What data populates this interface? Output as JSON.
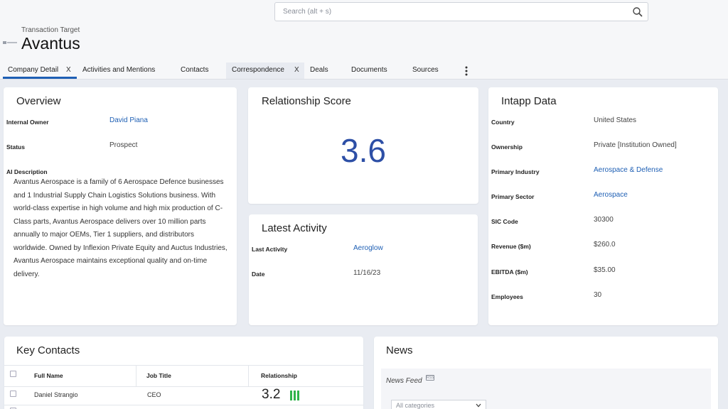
{
  "search": {
    "placeholder": "Search (alt + s)",
    "icon": "search-icon"
  },
  "header": {
    "subtitle": "Transaction Target",
    "title": "Avantus"
  },
  "tabs": [
    {
      "label": "Company Detail",
      "closable": true,
      "active": true
    },
    {
      "label": "Activities and Mentions"
    },
    {
      "label": "Contacts"
    },
    {
      "label": "Correspondence",
      "closable": true
    },
    {
      "label": "Deals"
    },
    {
      "label": "Documents"
    },
    {
      "label": "Sources"
    }
  ],
  "tab_close_label": "X",
  "overview": {
    "title": "Overview",
    "internal_owner_label": "Internal Owner",
    "internal_owner": "David Piana",
    "status_label": "Status",
    "status": "Prospect",
    "ai_description_label": "AI Description",
    "ai_description": "Avantus Aerospace is a family of 6 Aerospace Defence businesses and 1 Industrial Supply Chain Logistics Solutions business. With world-class expertise in high volume and high mix production of C-Class parts, Avantus Aerospace delivers over 10 million parts annually to major OEMs, Tier 1 suppliers, and distributors worldwide. Owned by Inflexion Private Equity and Auctus Industries, Avantus Aerospace maintains exceptional quality and on-time delivery."
  },
  "relationship_score": {
    "title": "Relationship Score",
    "value": "3.6",
    "color": "#2d4fa6"
  },
  "latest_activity": {
    "title": "Latest Activity",
    "last_activity_label": "Last Activity",
    "last_activity": "Aeroglow",
    "date_label": "Date",
    "date": "11/16/23"
  },
  "intapp_data": {
    "title": "Intapp Data",
    "fields": [
      {
        "label": "Country",
        "value": "United States",
        "link": false
      },
      {
        "label": "Ownership",
        "value": "Private [Institution Owned]",
        "link": false
      },
      {
        "label": "Primary Industry",
        "value": "Aerospace & Defense",
        "link": true
      },
      {
        "label": "Primary Sector",
        "value": "Aerospace",
        "link": true
      },
      {
        "label": "SIC Code",
        "value": "30300",
        "link": false
      },
      {
        "label": "Revenue ($m)",
        "value": "$260.0",
        "link": false
      },
      {
        "label": "EBITDA ($m)",
        "value": "$35.00",
        "link": false
      },
      {
        "label": "Employees",
        "value": "30",
        "link": false
      }
    ]
  },
  "key_contacts": {
    "title": "Key Contacts",
    "columns": [
      "Full Name",
      "Job Title",
      "Relationship"
    ],
    "rows": [
      {
        "name": "Daniel Strangio",
        "job_title": "CEO",
        "relationship": "3.2"
      }
    ]
  },
  "news": {
    "title": "News",
    "feed_label": "News Feed",
    "rss_badge": "RSS",
    "category_placeholder": "All categories"
  },
  "colors": {
    "accent": "#1e5fb4",
    "score_bars": "#2fb34b",
    "background": "#e9ecf2"
  }
}
